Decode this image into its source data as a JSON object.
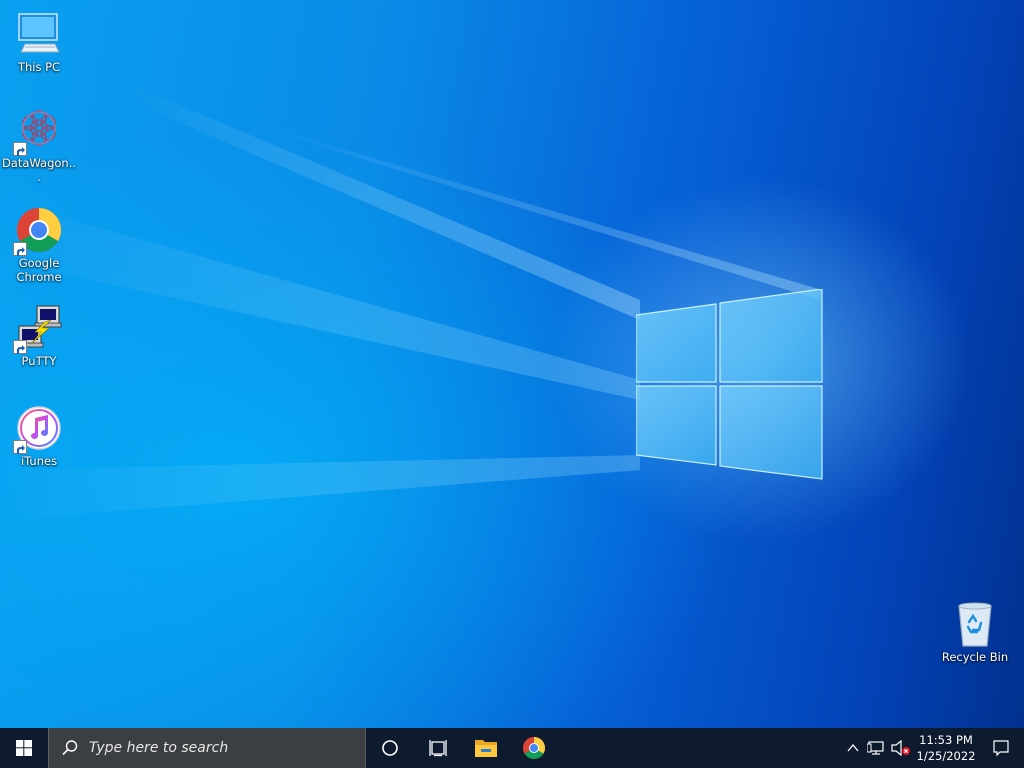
{
  "desktop": {
    "icons": [
      {
        "label": "This PC",
        "icon": "this-pc-icon"
      },
      {
        "label": "DataWagon...",
        "icon": "datawagon-icon"
      },
      {
        "label": "Google Chrome",
        "icon": "chrome-icon"
      },
      {
        "label": "PuTTY",
        "icon": "putty-icon"
      },
      {
        "label": "iTunes",
        "icon": "itunes-icon"
      },
      {
        "label": "Recycle Bin",
        "icon": "recycle-bin-icon"
      }
    ]
  },
  "taskbar": {
    "search_placeholder": "Type here to search",
    "pinned": [
      "cortana-icon",
      "task-view-icon",
      "file-explorer-icon",
      "chrome-icon"
    ],
    "tray_icons": [
      "show-hidden-icons-chevron",
      "network-icon",
      "volume-muted-icon"
    ],
    "clock": {
      "time": "11:53 PM",
      "date": "1/25/2022"
    },
    "notifications_icon": "action-center-icon"
  },
  "colors": {
    "taskbar_bg": "#0e1b2e",
    "search_bg": "#3c3f41",
    "wallpaper_primary": "#0a8ae6",
    "wallpaper_dark": "#02318f"
  }
}
